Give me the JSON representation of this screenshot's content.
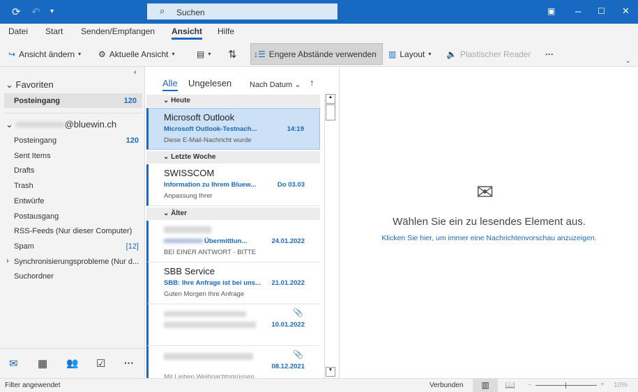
{
  "titlebar": {
    "search_placeholder": "Suchen"
  },
  "menu": [
    "Datei",
    "Start",
    "Senden/Empfangen",
    "Ansicht",
    "Hilfe"
  ],
  "ribbon": {
    "change_view": "Ansicht ändern",
    "current_view": "Aktuelle Ansicht",
    "compact": "Engere Abstände verwenden",
    "layout": "Layout",
    "reader": "Plastischer Reader",
    "more": "···"
  },
  "sidebar": {
    "favorites": "Favoriten",
    "fav_inbox": "Posteingang",
    "fav_inbox_count": "120",
    "account": "@bluewin.ch",
    "folders": [
      {
        "label": "Posteingang",
        "count": "120"
      },
      {
        "label": "Sent Items"
      },
      {
        "label": "Drafts"
      },
      {
        "label": "Trash"
      },
      {
        "label": "Entwürfe"
      },
      {
        "label": "Postausgang"
      },
      {
        "label": "RSS-Feeds (Nur dieser Computer)"
      },
      {
        "label": "Spam",
        "count": "[12]"
      },
      {
        "label": "Synchronisierungsprobleme (Nur d..."
      },
      {
        "label": "Suchordner"
      }
    ]
  },
  "list": {
    "tab_all": "Alle",
    "tab_unread": "Ungelesen",
    "sort": "Nach Datum",
    "groups": [
      "Heute",
      "Letzte Woche",
      "Älter"
    ],
    "messages": [
      {
        "sender": "Microsoft Outlook",
        "subject": "Microsoft Outlook-Testnach...",
        "date": "14:19",
        "preview": "Diese E-Mail-Nachricht wurde"
      },
      {
        "sender": "SWISSCOM",
        "subject": "Information zu Ihrem Bluew...",
        "date": "Do 03.03",
        "preview": "Anpassung Ihrer"
      },
      {
        "sender": "",
        "subject": "Übermittlun...",
        "date": "24.01.2022",
        "preview": "BEI EINER ANTWORT - BITTE"
      },
      {
        "sender": "SBB Service",
        "subject": "SBB: Ihre Anfrage ist bei uns...",
        "date": "21.01.2022",
        "preview": "Guten Morgen   Ihre Anfrage"
      },
      {
        "date": "10.01.2022"
      },
      {
        "date": "08.12.2021",
        "preview": "Mit Lieben Weihnachtsgrüssen"
      }
    ]
  },
  "reading": {
    "title": "Wählen Sie ein zu lesendes Element aus.",
    "link": "Klicken Sie hier, um immer eine Nachrichtenvorschau anzuzeigen."
  },
  "status": {
    "filter": "Filter angewendet",
    "connected": "Verbunden",
    "zoom": "10%"
  }
}
